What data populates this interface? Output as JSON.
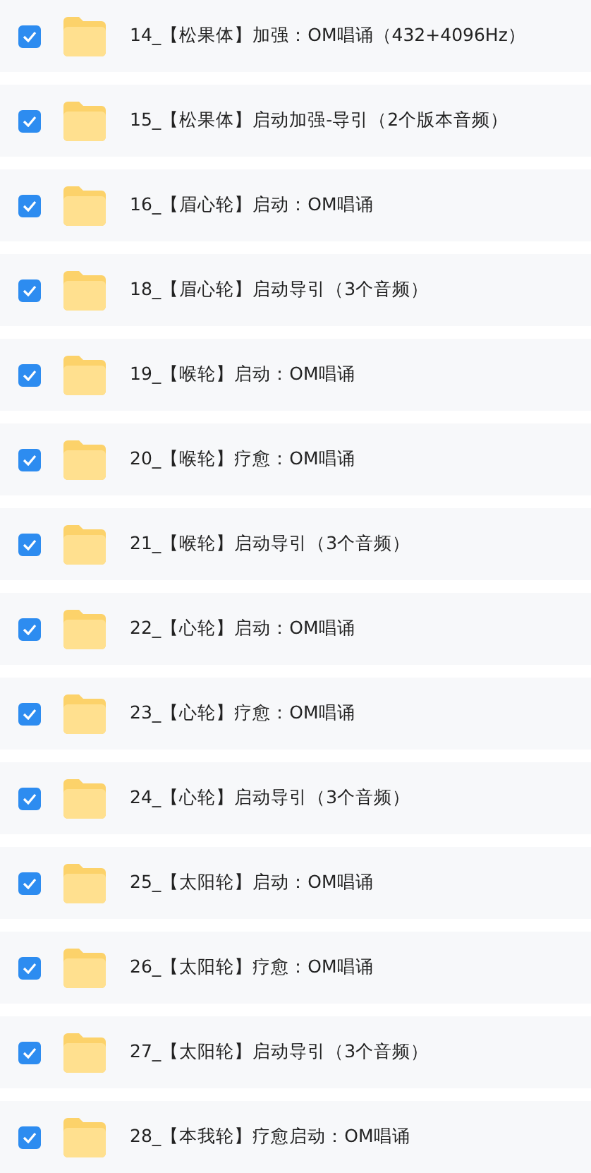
{
  "folders": [
    {
      "name": "14_【松果体】加强：OM唱诵（432+4096Hz）",
      "checked": true
    },
    {
      "name": "15_【松果体】启动加强-导引（2个版本音频）",
      "checked": true
    },
    {
      "name": "16_【眉心轮】启动：OM唱诵",
      "checked": true
    },
    {
      "name": "18_【眉心轮】启动导引（3个音频）",
      "checked": true
    },
    {
      "name": "19_【喉轮】启动：OM唱诵",
      "checked": true
    },
    {
      "name": "20_【喉轮】疗愈：OM唱诵",
      "checked": true
    },
    {
      "name": "21_【喉轮】启动导引（3个音频）",
      "checked": true
    },
    {
      "name": "22_【心轮】启动：OM唱诵",
      "checked": true
    },
    {
      "name": "23_【心轮】疗愈：OM唱诵",
      "checked": true
    },
    {
      "name": "24_【心轮】启动导引（3个音频）",
      "checked": true
    },
    {
      "name": "25_【太阳轮】启动：OM唱诵",
      "checked": true
    },
    {
      "name": "26_【太阳轮】疗愈：OM唱诵",
      "checked": true
    },
    {
      "name": "27_【太阳轮】启动导引（3个音频）",
      "checked": true
    },
    {
      "name": "28_【本我轮】疗愈启动：OM唱诵",
      "checked": true
    }
  ]
}
